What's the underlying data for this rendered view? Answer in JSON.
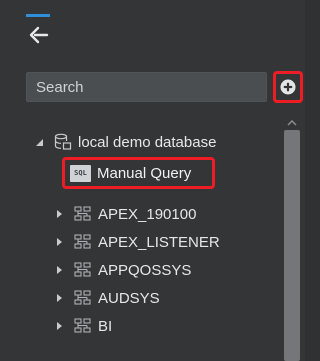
{
  "search": {
    "placeholder": "Search"
  },
  "tree": {
    "root": {
      "label": "local demo database",
      "icon": "database-icon"
    },
    "manual_query": {
      "label": "Manual Query",
      "badge": "SQL"
    },
    "schemas": [
      {
        "label": "APEX_190100"
      },
      {
        "label": "APEX_LISTENER"
      },
      {
        "label": "APPQOSSYS"
      },
      {
        "label": "AUDSYS"
      },
      {
        "label": "BI"
      }
    ]
  },
  "colors": {
    "accent": "#2f8fdd",
    "highlight": "#ee1c25",
    "background": "#333537"
  }
}
